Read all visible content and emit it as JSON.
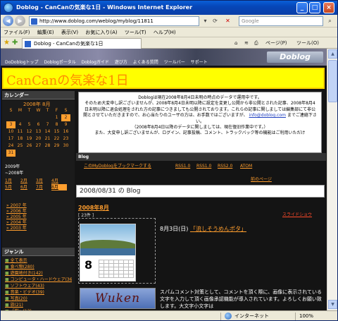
{
  "window": {
    "title": "Doblog - CanCanの気楽な1日 - Windows Internet Explorer"
  },
  "address": {
    "url": "http://www.doblog.com/weblog/myblog/11811",
    "search_placeholder": "Google"
  },
  "menu": [
    "ファイル(F)",
    "編集(E)",
    "表示(V)",
    "お気に入り(A)",
    "ツール(T)",
    "ヘルプ(H)"
  ],
  "tab": {
    "label": "Doblog - CanCanの気楽な1日"
  },
  "toolbar": {
    "page_label": "ページ(P)",
    "tools_label": "ツール(O)"
  },
  "site": {
    "nav": [
      "DoDoblogトップ",
      "Doblogポータル",
      "Doblogガイド",
      "遊び方",
      "よくある質問",
      "ツールバー",
      "サポート"
    ],
    "logo": "Doblog"
  },
  "blog_title": "CanCanの気楽な1日",
  "sidebar": {
    "calendar_heading": "カレンダー",
    "calendar_month": "2008年 8月",
    "weekdays": [
      "S",
      "M",
      "T",
      "W",
      "T",
      "F",
      "S"
    ],
    "weeks": [
      [
        "",
        "",
        "",
        "",
        "",
        "1",
        "2"
      ],
      [
        "3",
        "4",
        "5",
        "6",
        "7",
        "8",
        "9"
      ],
      [
        "10",
        "11",
        "12",
        "13",
        "14",
        "15",
        "16"
      ],
      [
        "17",
        "18",
        "19",
        "20",
        "21",
        "22",
        "23"
      ],
      [
        "24",
        "25",
        "26",
        "27",
        "28",
        "29",
        "30"
      ],
      [
        "31",
        "",
        "",
        "",
        "",
        "",
        ""
      ]
    ],
    "archive_year": "2009年",
    "archive_sub": "~2008年",
    "archive_months": [
      "1月",
      "2月",
      "3月",
      "4月",
      "5月",
      "6月",
      "7月",
      "8月"
    ],
    "years": [
      "» 2007 年",
      "» 2006 年",
      "» 2005 年",
      "» 2004 年",
      "» 2003 年"
    ],
    "genre_heading": "ジャンル",
    "genres": [
      "全て表示",
      "食べ物(280)",
      "遊園地付き(142)",
      "コンピュータ・ハードウェア(36)",
      "ソフトウェア(43)",
      "音楽・ビデオ(39)",
      "写真(20)",
      "旅(21)",
      "「猫」(13)",
      "CanCanの気楽なヒーローダム"
    ]
  },
  "notice": {
    "lines": [
      "Doblogは現在2008年8月4日未明の時点のデータで運用中です。",
      "そのため大変申し訳ございませんが、2008年8月4日未明以降に設定を変更し公開から非公開とされた記事、2008年8月4日未明以降に退会処理をされた方の記事につきましても公開されております。これらの記事に関しましては編集部にて非公開とさせていただきますので、お心当たりのユーザの方は、お手数ではございますが、",
      "までご連絡下さい。",
      "（2008年8月4日以降のデータに関しましては、現在復旧作業中です。）",
      "また、大変申し訳ございませんが、ログイン、記事投稿、コメント、トラックバック等の機能はご利用いただけ"
    ],
    "email": "info@doblog.com"
  },
  "blog_label": "Blog",
  "feeds": [
    "このMyDoblogをブックマークする",
    "RSS1.0",
    "RSS1.0",
    "RSS2.0",
    "ATOM"
  ],
  "prev_page": "前のページ",
  "date_heading": "2008/08/31 の Blog",
  "post": {
    "month": "2008年8月",
    "count": "[ 23件 ]",
    "slideshow": "スライドショウ",
    "date": "8月3日(日)",
    "title": "「流しそうめんポタ」",
    "thumb_day": "8",
    "second_image_text": "Wuken",
    "spam_text": "スパムコメント対策として、コメントを頂く際に、画像に表示されている文字を入力して頂く画像承認機能が導入されています。よろしくお願い致します。大文字小文字は"
  },
  "status": {
    "zone": "インターネット",
    "zoom": "100%"
  }
}
